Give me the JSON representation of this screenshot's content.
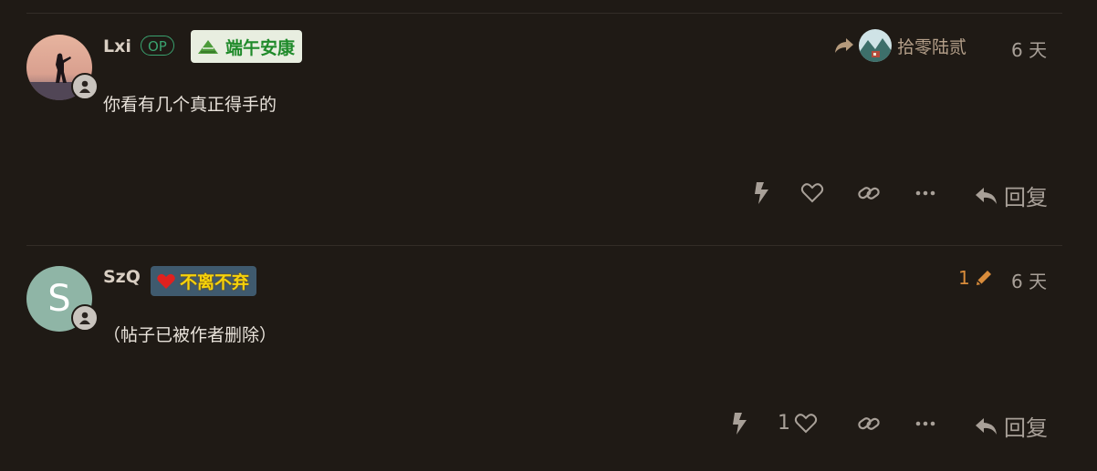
{
  "posts": [
    {
      "username": "Lxi",
      "op_badge": "OP",
      "flair": "端午安康",
      "reply_to": "拾零陆贰",
      "time": "6 天",
      "content": "你看有几个真正得手的",
      "likes": "",
      "reply_label": "回复"
    },
    {
      "username": "SzQ",
      "avatar_letter": "S",
      "flair": "不离不弃",
      "edit_count": "1",
      "time": "6 天",
      "content": "（帖子已被作者删除）",
      "likes": "1",
      "reply_label": "回复"
    }
  ],
  "colors": {
    "background": "#1f1a15",
    "op_green": "#3aa26f",
    "edit_orange": "#d98c3b",
    "avatar_s": "#8fb5a6"
  }
}
